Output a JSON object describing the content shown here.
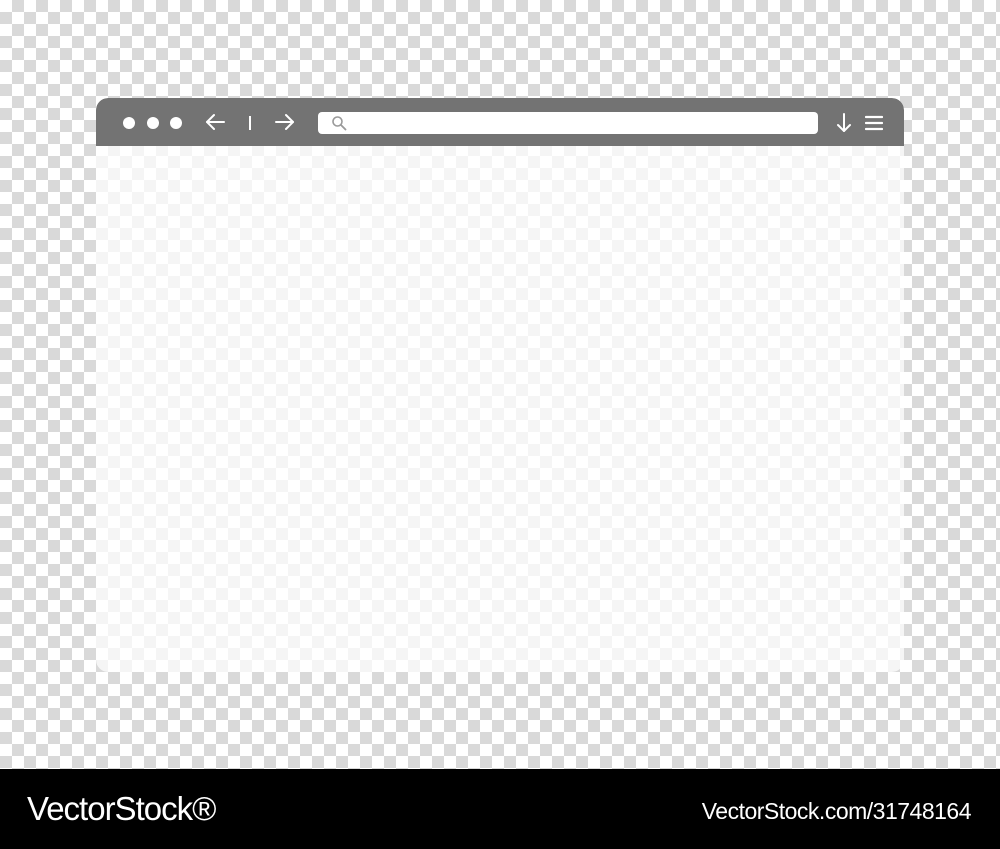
{
  "browser": {
    "toolbar_color": "#737373",
    "window_controls": [
      {
        "name": "window-dot-1",
        "icon": "circle-icon"
      },
      {
        "name": "window-dot-2",
        "icon": "circle-icon"
      },
      {
        "name": "window-dot-3",
        "icon": "circle-icon"
      }
    ],
    "navigation": {
      "back_icon": "arrow-left-icon",
      "forward_icon": "arrow-right-icon"
    },
    "address_bar": {
      "value": "",
      "placeholder": "",
      "icon": "search-icon"
    },
    "actions": {
      "download_icon": "arrow-down-icon",
      "menu_icon": "hamburger-menu-icon"
    }
  },
  "footer": {
    "brand": "VectorStock®",
    "image_id": "VectorStock.com/31748164"
  }
}
